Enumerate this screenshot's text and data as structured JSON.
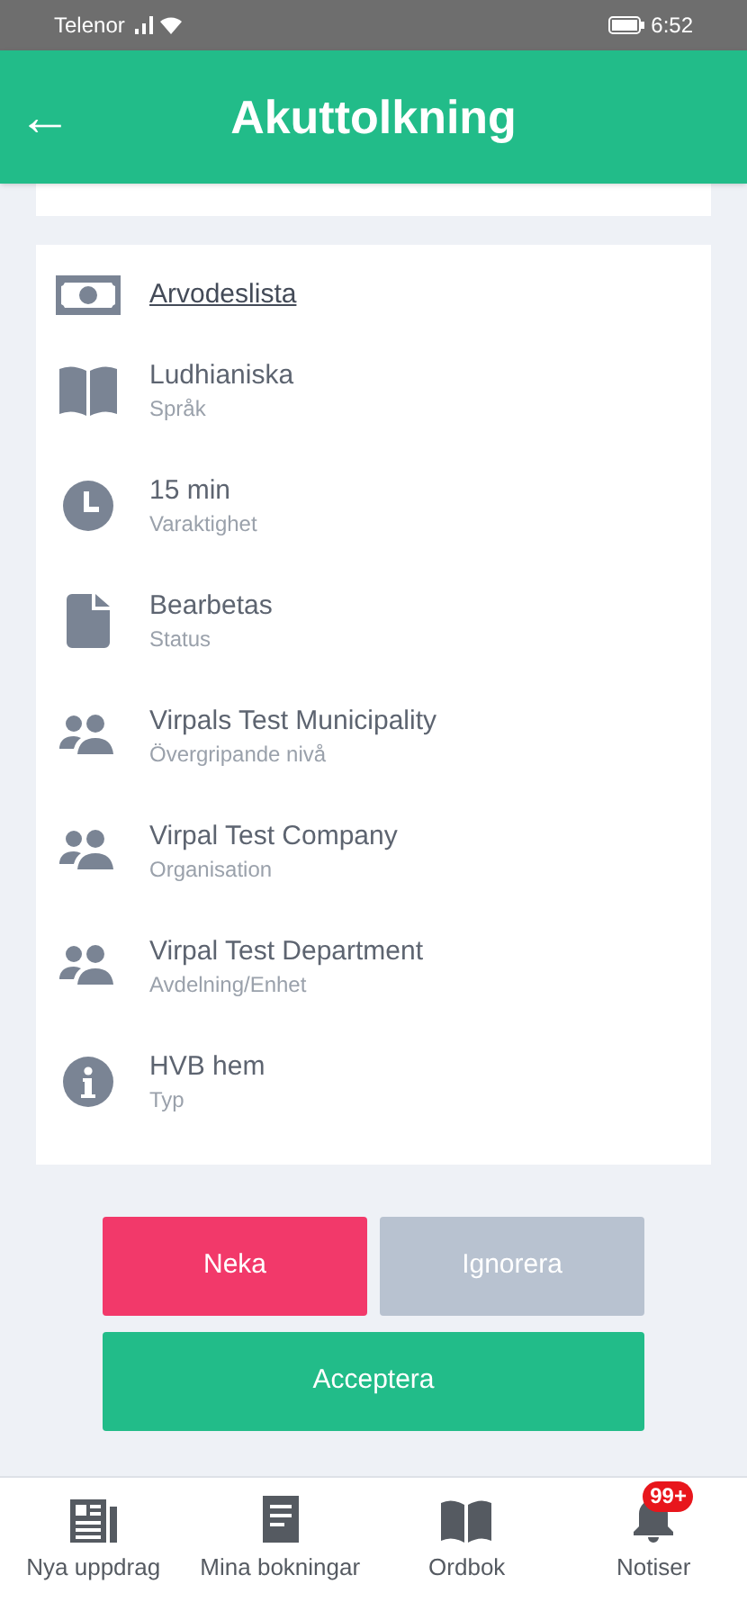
{
  "status_bar": {
    "carrier": "Telenor",
    "time": "6:52"
  },
  "header": {
    "back_icon": "←",
    "title": "Akuttolkning"
  },
  "fee_link": {
    "label": "Arvodeslista"
  },
  "details": [
    {
      "kind": "book",
      "value": "Ludhianiska",
      "label": "Språk"
    },
    {
      "kind": "clock",
      "value": "15 min",
      "label": "Varaktighet"
    },
    {
      "kind": "file",
      "value": "Bearbetas",
      "label": "Status"
    },
    {
      "kind": "people",
      "value": "Virpals Test Municipality",
      "label": "Övergripande nivå"
    },
    {
      "kind": "people",
      "value": "Virpal Test Company",
      "label": "Organisation"
    },
    {
      "kind": "people",
      "value": "Virpal Test Department",
      "label": "Avdelning/Enhet"
    },
    {
      "kind": "info",
      "value": "HVB hem",
      "label": "Typ"
    }
  ],
  "buttons": [
    {
      "kind": "danger",
      "label": "Neka"
    },
    {
      "kind": "muted",
      "label": "Ignorera"
    },
    {
      "kind": "primary",
      "label": "Acceptera"
    }
  ],
  "bottom_nav": [
    {
      "kind": "news",
      "label": "Nya uppdrag"
    },
    {
      "kind": "doc",
      "label": "Mina bokningar"
    },
    {
      "kind": "book",
      "label": "Ordbok"
    },
    {
      "kind": "bell",
      "label": "Notiser",
      "badge": "99+"
    }
  ]
}
